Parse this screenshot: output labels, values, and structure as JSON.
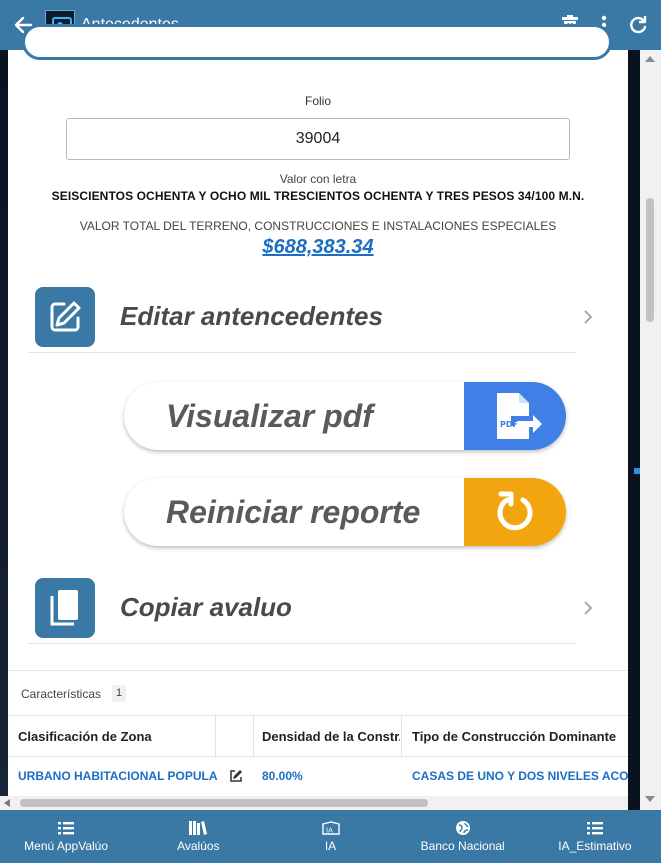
{
  "header": {
    "title": "Antecedentes",
    "icons": [
      "back-arrow-icon",
      "app-logo",
      "trash-icon",
      "more-vert-icon",
      "refresh-icon"
    ]
  },
  "folio": {
    "label": "Folio",
    "value": "39004"
  },
  "valor_letra": {
    "label": "Valor con letra",
    "value": "SEISCIENTOS OCHENTA Y OCHO MIL TRESCIENTOS OCHENTA Y TRES PESOS 34/100 M.N."
  },
  "valor_total": {
    "label": "VALOR TOTAL DEL TERRENO, CONSTRUCCIONES E INSTALACIONES ESPECIALES",
    "value": "$688,383.34"
  },
  "actions": {
    "editar": {
      "label": "Editar antencedentes",
      "icon": "pencil-icon"
    },
    "visualizar": {
      "label": "Visualizar pdf",
      "icon": "pdf-export-icon",
      "color": "#3f7fe6"
    },
    "reiniciar": {
      "label": "Reiniciar reporte",
      "icon": "restart-icon",
      "color": "#f2a50f"
    },
    "copiar": {
      "label": "Copiar avaluo",
      "icon": "copy-icon"
    }
  },
  "caracteristicas": {
    "title": "Características",
    "count": "1",
    "columns": [
      "Clasificación de Zona",
      "Densidad de la Constr...",
      "Tipo de Construcción Dominante"
    ],
    "row": {
      "zona": "URBANO HABITACIONAL POPULAR",
      "densidad": "80.00%",
      "tipo": "CASAS DE UNO Y DOS NIVELES ACORD"
    }
  },
  "nav": {
    "items": [
      {
        "label": "Menú AppValúo",
        "icon": "list-icon"
      },
      {
        "label": "Avalúos",
        "icon": "books-icon"
      },
      {
        "label": "IA",
        "icon": "ia-icon"
      },
      {
        "label": "Banco Nacional",
        "icon": "globe-icon"
      },
      {
        "label": "IA_Estimativo",
        "icon": "list-icon"
      }
    ]
  },
  "colors": {
    "primary": "#3a78a5",
    "link": "#1a6fc2"
  }
}
